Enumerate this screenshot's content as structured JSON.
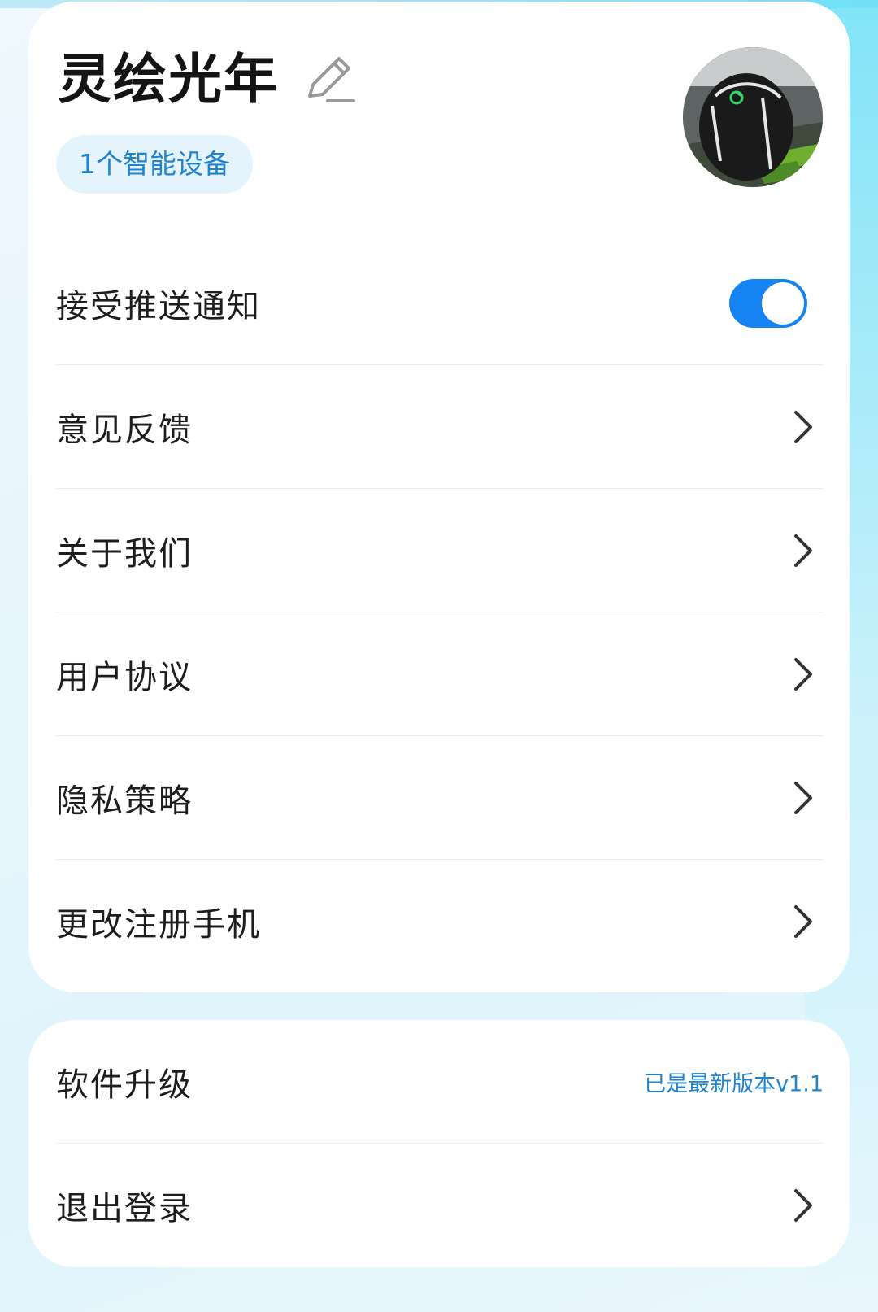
{
  "profile": {
    "name": "灵绘光年",
    "device_badge": "1个智能设备"
  },
  "settings": {
    "push_label": "接受推送通知",
    "push_enabled": true,
    "items": [
      {
        "label": "意见反馈"
      },
      {
        "label": "关于我们"
      },
      {
        "label": "用户协议"
      },
      {
        "label": "隐私策略"
      },
      {
        "label": "更改注册手机"
      }
    ]
  },
  "bottom": {
    "upgrade_label": "软件升级",
    "version_status": "已是最新版本v1.1",
    "logout_label": "退出登录"
  },
  "colors": {
    "accent": "#1583f1",
    "badge_text": "#1f84cf",
    "badge_bg": "#e5f4fc"
  },
  "icons": {
    "edit": "pencil-icon",
    "chevron": "chevron-right-icon",
    "avatar": "gaming-mouse-photo"
  }
}
